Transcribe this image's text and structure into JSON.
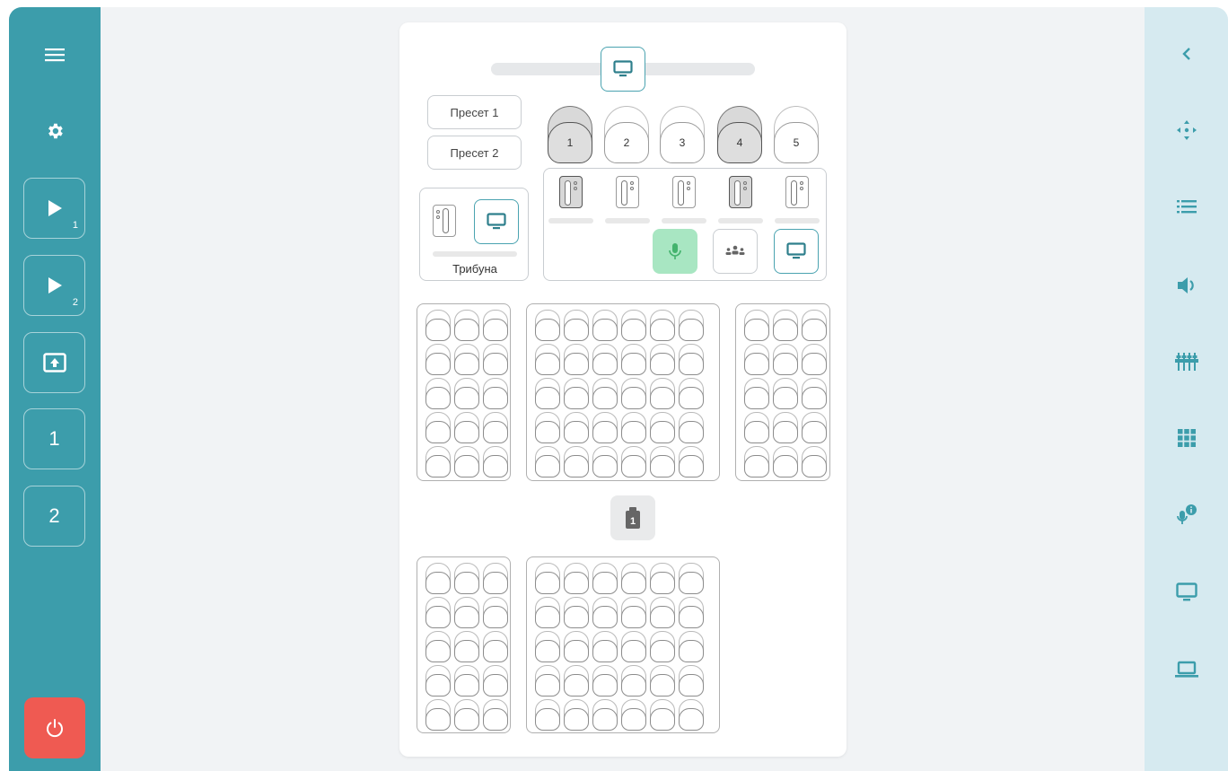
{
  "left_sidebar": {
    "items": [
      {
        "icon": "menu-icon"
      },
      {
        "icon": "gear-icon"
      },
      {
        "icon": "play-icon",
        "sub": "1"
      },
      {
        "icon": "play-icon",
        "sub": "2"
      },
      {
        "icon": "upload-box-icon"
      },
      {
        "label": "1"
      },
      {
        "label": "2"
      },
      {
        "icon": "power-icon"
      }
    ],
    "colors": {
      "background": "#3c9dab",
      "power": "#ef5a52"
    }
  },
  "right_sidebar": {
    "icons": [
      "chevron-left-icon",
      "move-arrows-icon",
      "list-icon",
      "volume-icon",
      "mixer-icon",
      "grid-icon",
      "mic-info-icon",
      "monitor-icon",
      "laptop-icon"
    ],
    "colors": {
      "background": "#d6eaf0",
      "accent": "#3c9dab"
    }
  },
  "room": {
    "presets": [
      "Пресет 1",
      "Пресет 2"
    ],
    "stage_seats": [
      {
        "label": "1",
        "active": true
      },
      {
        "label": "2",
        "active": false
      },
      {
        "label": "3",
        "active": false
      },
      {
        "label": "4",
        "active": true
      },
      {
        "label": "5",
        "active": false
      }
    ],
    "tribune_label": "Трибуна",
    "marker_label": "1",
    "colors": {
      "mic_active": "#a8e6c2",
      "mic_icon": "#43b36d",
      "screen": "#4aa3b0"
    }
  }
}
